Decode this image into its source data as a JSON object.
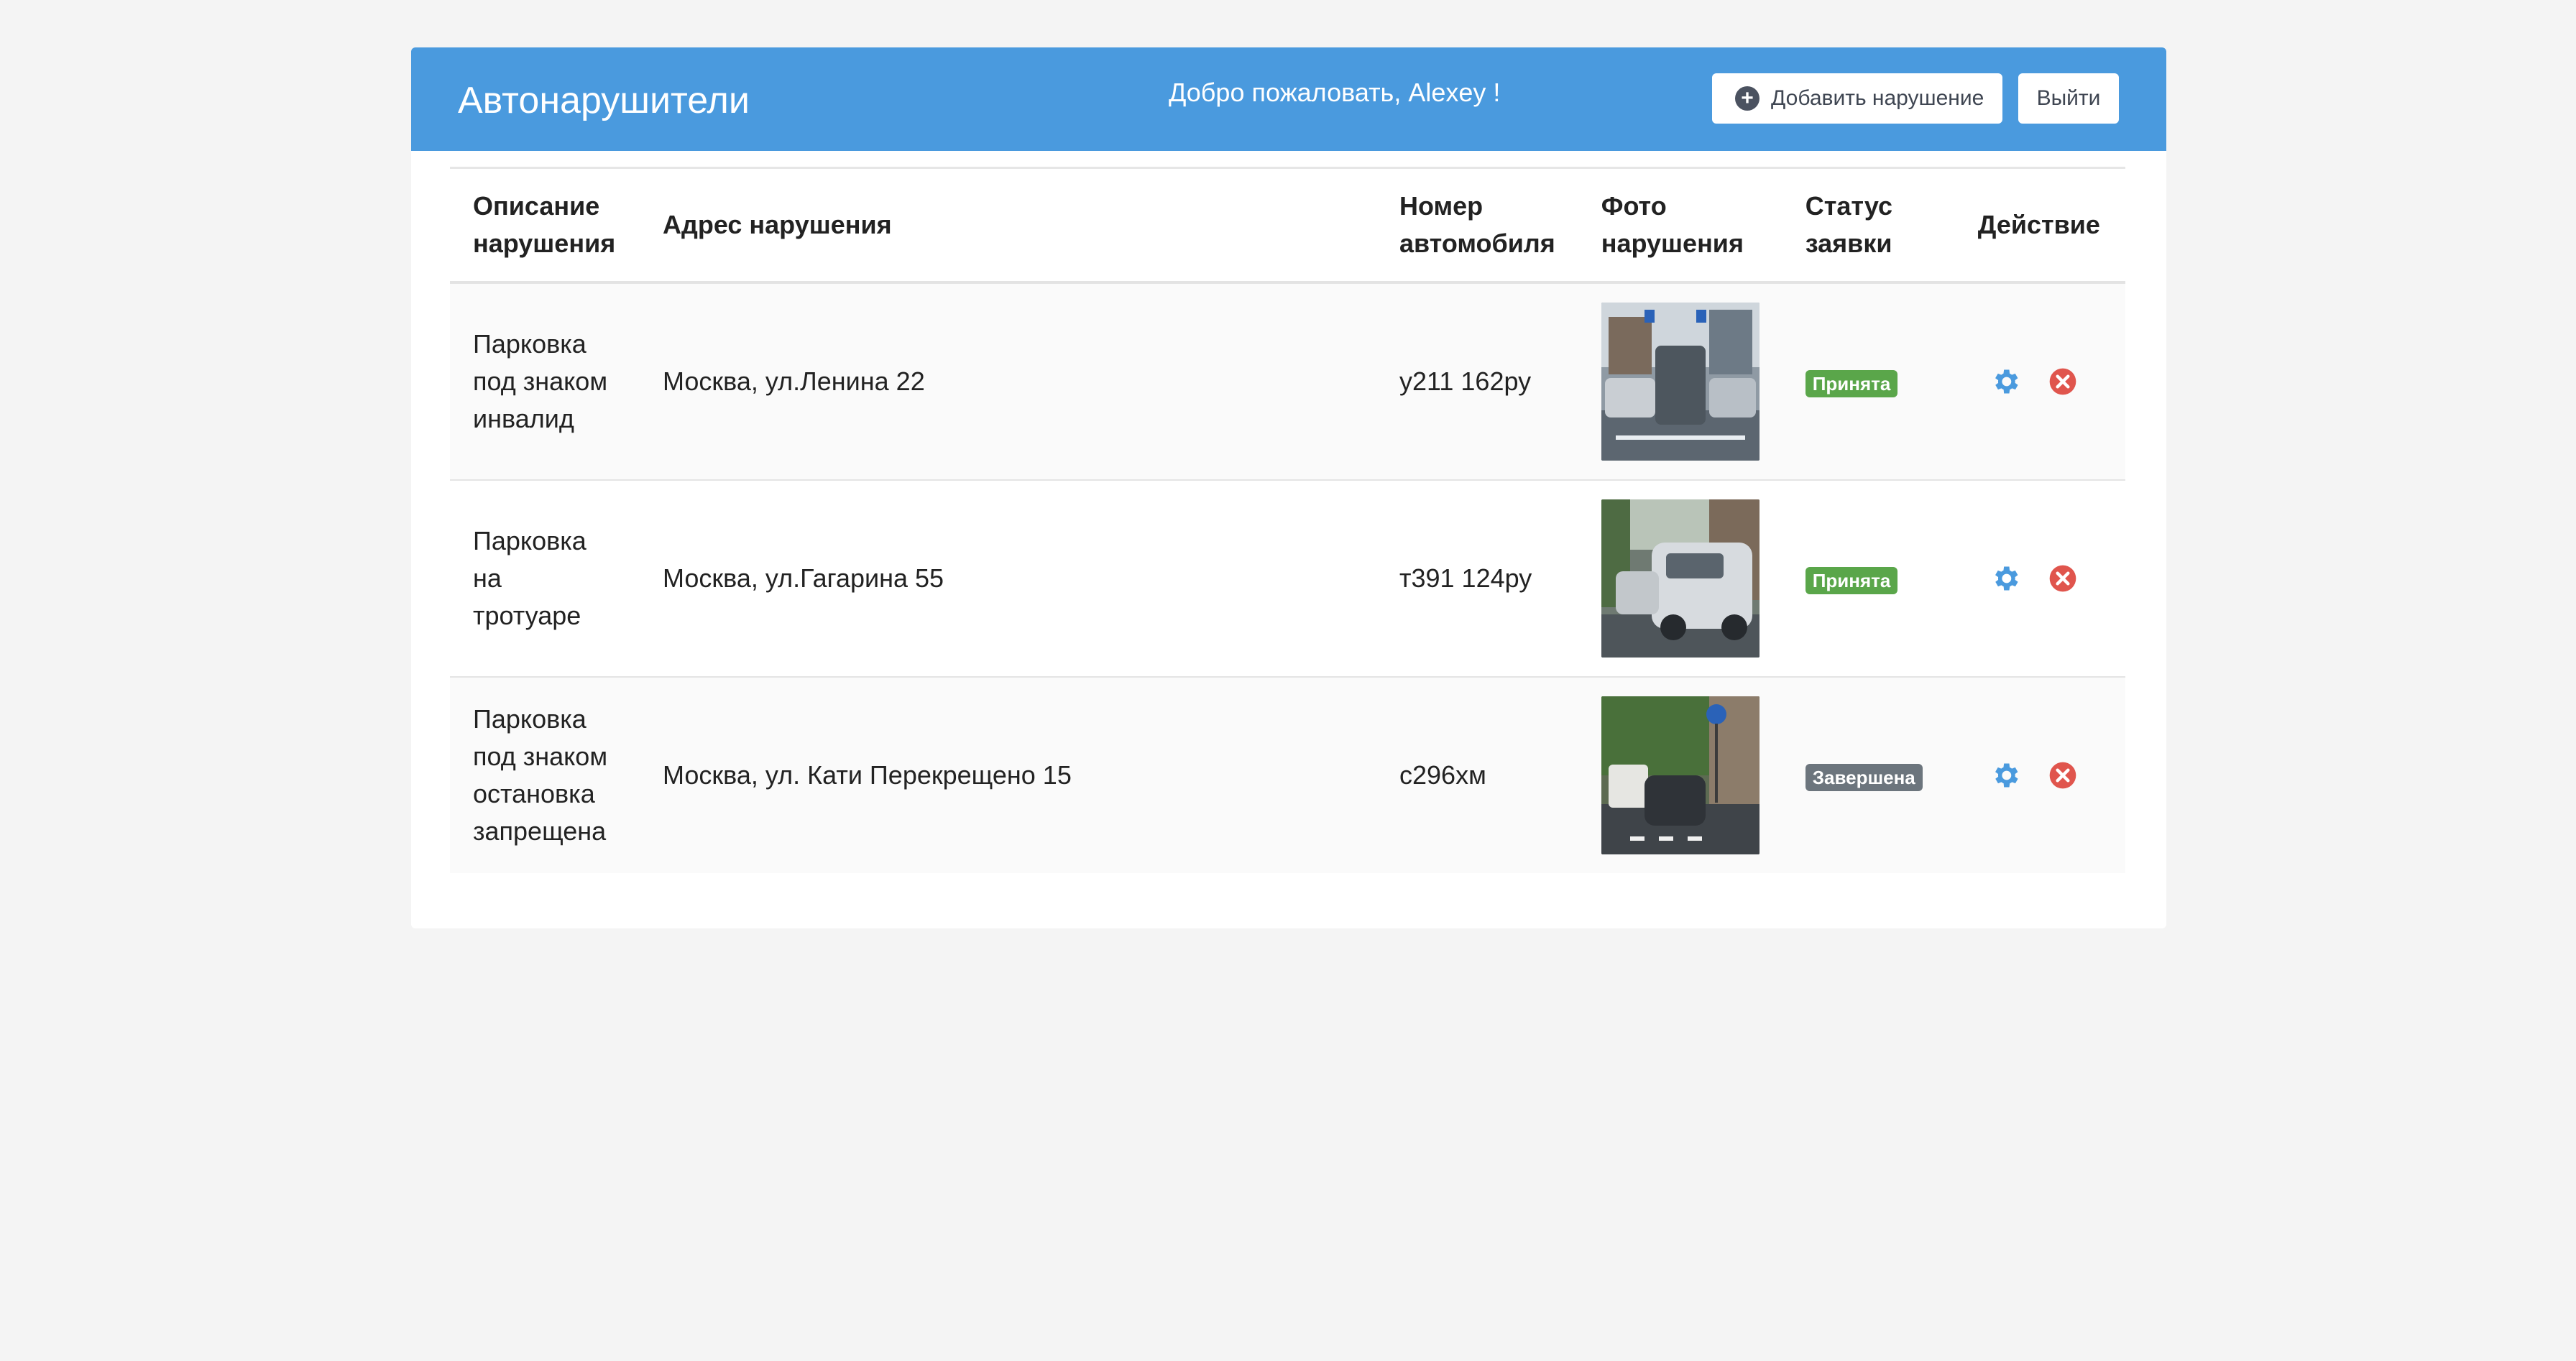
{
  "header": {
    "brand": "Автонарушители",
    "welcome": "Добро пожаловать, Alexey !",
    "add_button": "Добавить нарушение",
    "logout_button": "Выйти"
  },
  "table": {
    "columns": [
      "Описание нарушения",
      "Адрес нарушения",
      "Номер автомобиля",
      "Фото нарушения",
      "Статус заявки",
      "Действие"
    ],
    "rows": [
      {
        "description": "Парковка под знаком инвалид",
        "address": "Москва, ул.Ленина 22",
        "plate": "у211 162ру",
        "status": "Принята",
        "status_color": "#5aa64a"
      },
      {
        "description": "Парковка на тротуаре",
        "address": "Москва, ул.Гагарина 55",
        "plate": "т391 124ру",
        "status": "Принята",
        "status_color": "#5aa64a"
      },
      {
        "description": "Парковка под знаком остановка запрещена",
        "address": "Москва, ул. Кати Перекрещено 15",
        "plate": "с296хм",
        "status": "Завершена",
        "status_color": "#6c757d"
      }
    ]
  },
  "icons": {
    "settings": "gear-icon",
    "delete": "close-circle-icon",
    "add": "plus-circle-icon"
  },
  "colors": {
    "header": "#4a9ade",
    "accent_blue": "#4a9ade",
    "delete_red": "#e0554d"
  }
}
